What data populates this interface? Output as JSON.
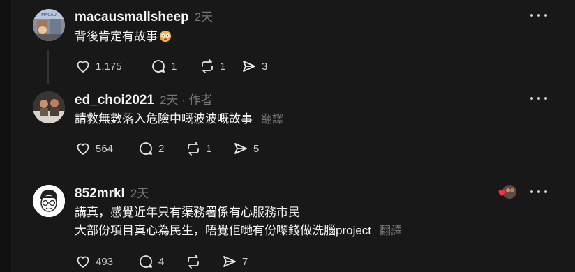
{
  "comments": [
    {
      "username": "macausmallsheep",
      "time": "2天",
      "text": "背後肯定有故事",
      "emoji": "flushed-face",
      "stats": {
        "likes": "1,175",
        "replies": "1",
        "reposts": "1",
        "shares": "3"
      }
    },
    {
      "username": "ed_choi2021",
      "time": "2天",
      "author_tag": "· 作者",
      "text": "請救無數落入危險中嘅波波嘅故事",
      "translate": "翻譯",
      "stats": {
        "likes": "564",
        "replies": "2",
        "reposts": "1",
        "shares": "5"
      }
    },
    {
      "username": "852mrkl",
      "time": "2天",
      "text_line1": "講真，感覺近年只有渠務署係有心服務市民",
      "text_line2": "大部份項目真心為民生，唔覺佢哋有份嚟錢做洗腦project",
      "translate": "翻譯",
      "stats": {
        "likes": "493",
        "replies": "4",
        "shares": "7"
      }
    }
  ],
  "colors": {
    "background": "#181818",
    "text": "#f3f5f7",
    "muted": "#777777",
    "heart": "#ff3040"
  }
}
